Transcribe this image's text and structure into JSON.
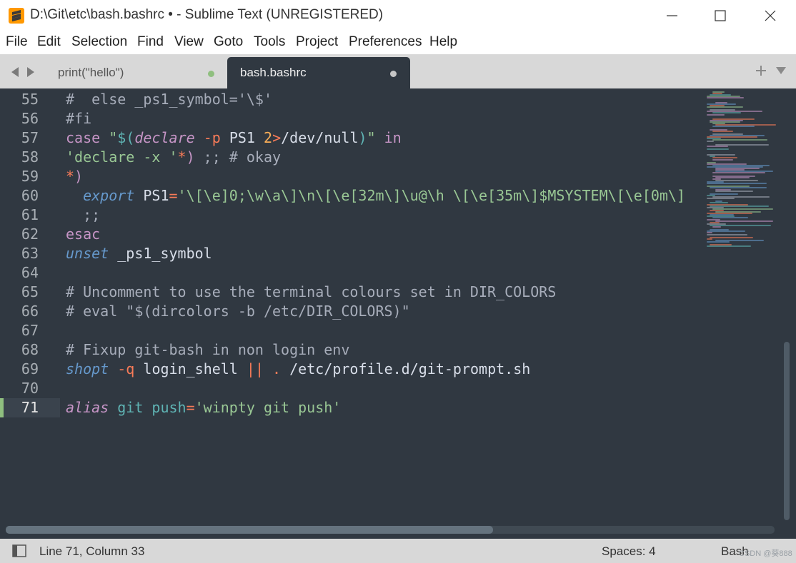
{
  "window": {
    "title": "D:\\Git\\etc\\bash.bashrc • - Sublime Text (UNREGISTERED)"
  },
  "menu": [
    "File",
    "Edit",
    "Selection",
    "Find",
    "View",
    "Goto",
    "Tools",
    "Project",
    "Preferences",
    "Help"
  ],
  "tabs": [
    {
      "label": "print(\"hello\")",
      "active": false,
      "modified": true
    },
    {
      "label": "bash.bashrc",
      "active": true,
      "modified": true
    }
  ],
  "editor": {
    "current_line": 71,
    "lines": [
      {
        "num": "55",
        "tokens": [
          {
            "t": "#  else _ps1_symbol='\\$'",
            "c": "comment"
          }
        ]
      },
      {
        "num": "56",
        "tokens": [
          {
            "t": "#fi",
            "c": "comment"
          }
        ]
      },
      {
        "num": "57",
        "tokens": [
          {
            "t": "case",
            "c": "kw"
          },
          {
            "t": " ",
            "c": "plain"
          },
          {
            "t": "\"",
            "c": "str"
          },
          {
            "t": "$(",
            "c": "str2"
          },
          {
            "t": "declare",
            "c": "fn"
          },
          {
            "t": " ",
            "c": "plain"
          },
          {
            "t": "-p",
            "c": "op"
          },
          {
            "t": " PS1 ",
            "c": "plain"
          },
          {
            "t": "2",
            "c": "num"
          },
          {
            "t": ">",
            "c": "op"
          },
          {
            "t": "/dev/null",
            "c": "plain"
          },
          {
            "t": ")",
            "c": "str2"
          },
          {
            "t": "\"",
            "c": "str"
          },
          {
            "t": " ",
            "c": "plain"
          },
          {
            "t": "in",
            "c": "kw"
          }
        ]
      },
      {
        "num": "58",
        "tokens": [
          {
            "t": "'declare -x '",
            "c": "str"
          },
          {
            "t": "*",
            "c": "op"
          },
          {
            "t": ")",
            "c": "kw"
          },
          {
            "t": " ;; # okay",
            "c": "comment"
          }
        ]
      },
      {
        "num": "59",
        "tokens": [
          {
            "t": "*",
            "c": "op"
          },
          {
            "t": ")",
            "c": "kw"
          }
        ]
      },
      {
        "num": "60",
        "tokens": [
          {
            "t": "  ",
            "c": "plain"
          },
          {
            "t": "export",
            "c": "ital"
          },
          {
            "t": " PS1",
            "c": "plain"
          },
          {
            "t": "=",
            "c": "op"
          },
          {
            "t": "'\\[\\e]0;\\w\\a\\]\\n\\[\\e[32m\\]\\u@\\h \\[\\e[35m\\]$MSYSTEM\\[\\e[0m\\]",
            "c": "str"
          }
        ]
      },
      {
        "num": "61",
        "tokens": [
          {
            "t": "  ;;",
            "c": "comment"
          }
        ]
      },
      {
        "num": "62",
        "tokens": [
          {
            "t": "esac",
            "c": "kw"
          }
        ]
      },
      {
        "num": "63",
        "tokens": [
          {
            "t": "unset",
            "c": "ital"
          },
          {
            "t": " _ps1_symbol",
            "c": "plain"
          }
        ]
      },
      {
        "num": "64",
        "tokens": []
      },
      {
        "num": "65",
        "tokens": [
          {
            "t": "# Uncomment to use the terminal colours set in DIR_COLORS",
            "c": "comment"
          }
        ]
      },
      {
        "num": "66",
        "tokens": [
          {
            "t": "# eval \"$(dircolors -b /etc/DIR_COLORS)\"",
            "c": "comment"
          }
        ]
      },
      {
        "num": "67",
        "tokens": []
      },
      {
        "num": "68",
        "tokens": [
          {
            "t": "# Fixup git-bash in non login env",
            "c": "comment"
          }
        ]
      },
      {
        "num": "69",
        "tokens": [
          {
            "t": "shopt",
            "c": "ital"
          },
          {
            "t": " ",
            "c": "plain"
          },
          {
            "t": "-q",
            "c": "op"
          },
          {
            "t": " login_shell ",
            "c": "plain"
          },
          {
            "t": "||",
            "c": "op"
          },
          {
            "t": " ",
            "c": "plain"
          },
          {
            "t": ".",
            "c": "op"
          },
          {
            "t": " /etc/profile.d/git-prompt.sh",
            "c": "plain"
          }
        ]
      },
      {
        "num": "70",
        "tokens": []
      },
      {
        "num": "71",
        "tokens": [
          {
            "t": "alias",
            "c": "fn"
          },
          {
            "t": " git push",
            "c": "str2"
          },
          {
            "t": "=",
            "c": "op"
          },
          {
            "t": "'winpty git push'",
            "c": "str"
          }
        ]
      }
    ]
  },
  "status": {
    "position": "Line 71, Column 33",
    "spaces": "Spaces: 4",
    "syntax": "Bash",
    "watermark": "CSDN @葵888"
  },
  "colors": {
    "editor_bg": "#303841",
    "chrome_bg": "#d8d8d8",
    "modified_dot": "#8fbf7f",
    "app_icon": "#ff9800"
  },
  "icons": {
    "app": "sublime-logo-icon",
    "minimize": "minimize-icon",
    "maximize": "maximize-icon",
    "close": "close-icon"
  }
}
